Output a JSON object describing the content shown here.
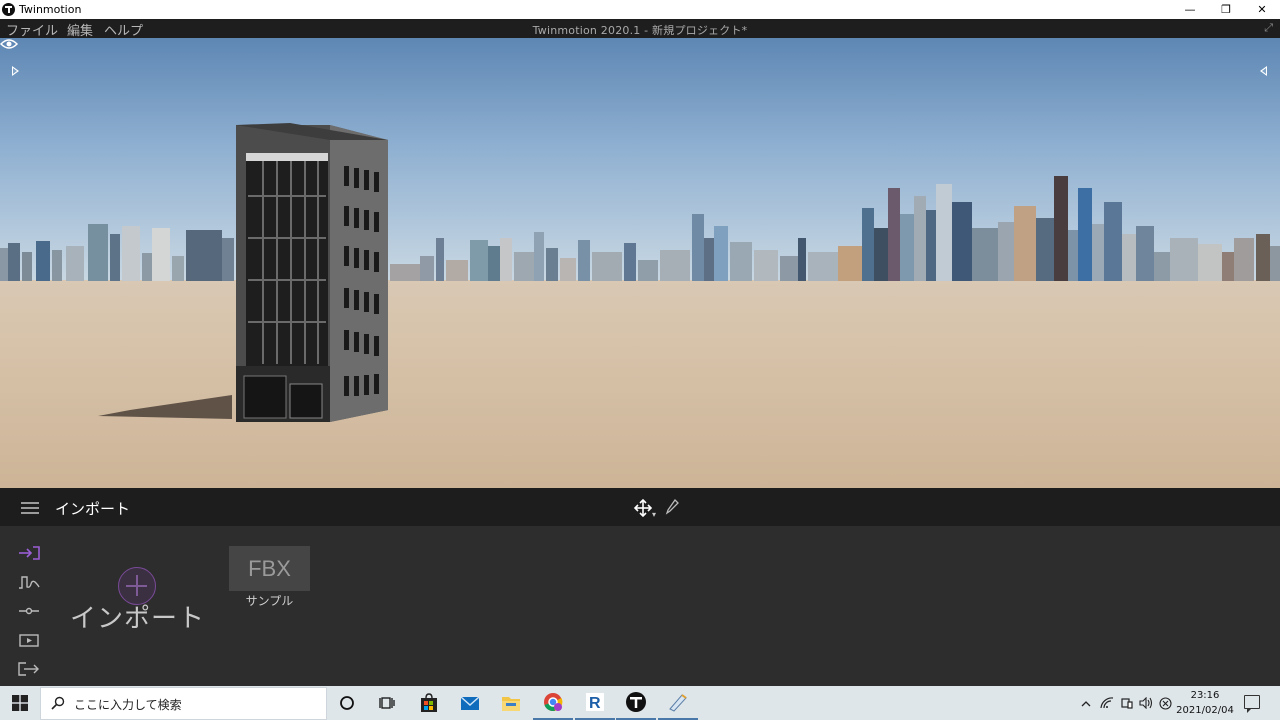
{
  "window": {
    "app_title": "Twinmotion",
    "minimize": "—",
    "restore": "❐",
    "close": "✕"
  },
  "menu": {
    "items": [
      "ファイル",
      "編集",
      "ヘルプ"
    ],
    "project_title": "Twinmotion 2020.1 - 新規プロジェクト*"
  },
  "panel": {
    "title": "インポート",
    "import_label": "インポート",
    "samples": [
      {
        "thumb": "FBX",
        "label": "サンプル"
      }
    ]
  },
  "colors": {
    "accent": "#9b5fd6",
    "menubar": "#1e1e1e",
    "panel_bg": "#2d2d2d"
  },
  "taskbar": {
    "search_placeholder": "ここに入力して検索",
    "time": "23:16",
    "date": "2021/02/04",
    "apps": [
      "cortana-icon",
      "task-view-icon",
      "store-icon",
      "mail-icon",
      "file-explorer-icon",
      "chrome-icon",
      "revit-icon",
      "twinmotion-icon",
      "sketch-icon"
    ]
  }
}
